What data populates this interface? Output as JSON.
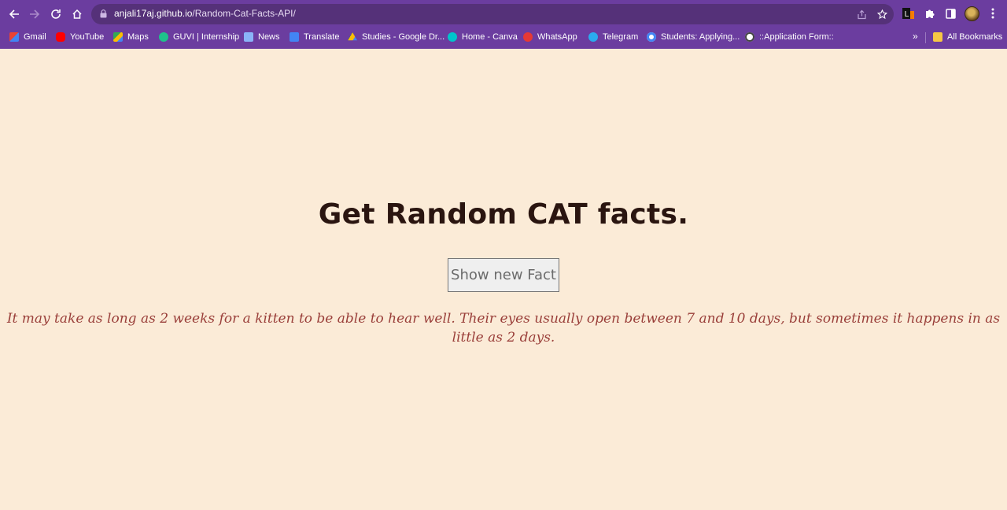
{
  "browser": {
    "url_host": "anjali17aj.github.io",
    "url_path": "/Random-Cat-Facts-API/",
    "bookmarks": [
      {
        "label": "Gmail",
        "icon": "gmail-icon",
        "color": "#ea4335"
      },
      {
        "label": "YouTube",
        "icon": "youtube-icon",
        "color": "#ff0000"
      },
      {
        "label": "Maps",
        "icon": "maps-icon",
        "color": "#34a853"
      },
      {
        "label": "GUVI | Internship",
        "icon": "guvi-icon",
        "color": "#1ec28b"
      },
      {
        "label": "News",
        "icon": "news-icon",
        "color": "#8ab4f8"
      },
      {
        "label": "Translate",
        "icon": "translate-icon",
        "color": "#4285f4"
      },
      {
        "label": "Studies - Google Dr...",
        "icon": "drive-icon",
        "color": "#fbbc04"
      },
      {
        "label": "Home - Canva",
        "icon": "canva-icon",
        "color": "#00c4cc"
      },
      {
        "label": "WhatsApp",
        "icon": "whatsapp-icon",
        "color": "#e53935"
      },
      {
        "label": "Telegram",
        "icon": "telegram-icon",
        "color": "#2aabee"
      },
      {
        "label": "Students: Applying...",
        "icon": "google-icon",
        "color": "#ffffff"
      },
      {
        "label": "::Application Form::",
        "icon": "globe-icon",
        "color": "#ffffff"
      }
    ],
    "overflow_label": "»",
    "all_bookmarks_label": "All Bookmarks"
  },
  "page": {
    "heading": "Get Random CAT facts.",
    "button_label": "Show new Fact",
    "fact": "It may take as long as 2 weeks for a kitten to be able to hear well. Their eyes usually open between 7 and 10 days, but sometimes it happens in as little as 2 days."
  },
  "colors": {
    "chrome": "#6b3d9f",
    "page_background": "#fbebd7",
    "heading": "#2a1510",
    "fact_text": "#9a3f3a"
  }
}
